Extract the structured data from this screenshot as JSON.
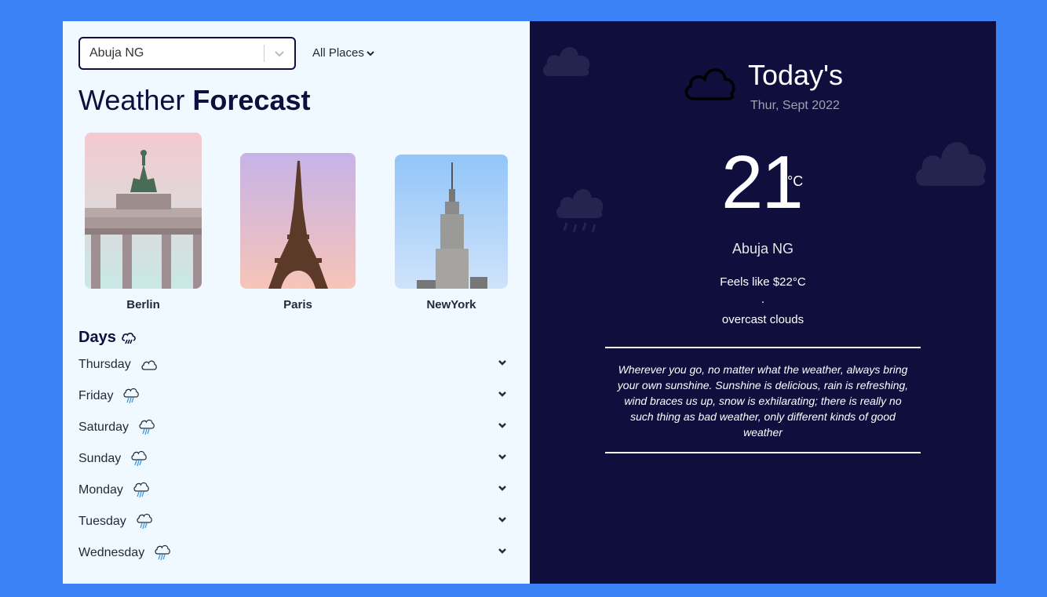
{
  "search": {
    "value": "Abuja NG"
  },
  "places_menu": {
    "label": "All Places"
  },
  "title": {
    "light": "Weather ",
    "bold": "Forecast"
  },
  "cities": [
    {
      "name": "Berlin"
    },
    {
      "name": "Paris"
    },
    {
      "name": "NewYork"
    }
  ],
  "days_header": "Days",
  "days": [
    {
      "label": "Thursday",
      "icon": "cloud-icon"
    },
    {
      "label": "Friday",
      "icon": "rain-cloud-icon"
    },
    {
      "label": "Saturday",
      "icon": "rain-cloud-icon"
    },
    {
      "label": "Sunday",
      "icon": "rain-cloud-icon"
    },
    {
      "label": "Monday",
      "icon": "rain-cloud-icon"
    },
    {
      "label": "Tuesday",
      "icon": "rain-cloud-icon"
    },
    {
      "label": "Wednesday",
      "icon": "rain-cloud-icon"
    }
  ],
  "today": {
    "title": "Today's",
    "date": "Thur, Sept 2022",
    "temp": "21",
    "unit": "°C",
    "location": "Abuja NG",
    "feels_like": "Feels like $22°C",
    "separator": ".",
    "description": "overcast clouds",
    "quote": "Wherever you go, no matter what the weather, always bring your own sunshine. Sunshine is delicious, rain is refreshing, wind braces us up, snow is exhilarating; there is really no such thing as bad weather, only different kinds of good weather"
  },
  "colors": {
    "page_bg": "#3b82f6",
    "left_bg": "#f0f9ff",
    "right_bg": "#0f0e3d",
    "rain": "#3b9ae1"
  }
}
